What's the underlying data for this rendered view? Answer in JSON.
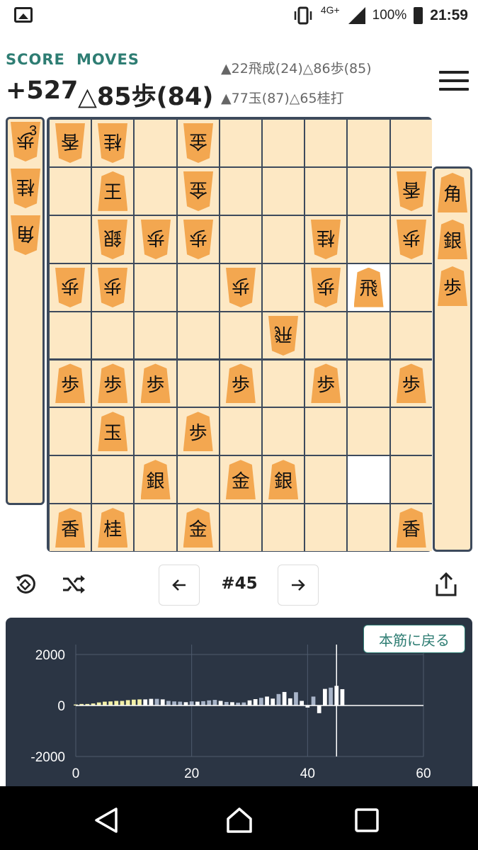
{
  "status_bar": {
    "network": "4G+",
    "battery": "100%",
    "time": "21:59"
  },
  "header": {
    "score_label": "SCORE",
    "moves_label": "MOVES",
    "score": "+527",
    "current_move": "△85歩(84)",
    "history_line1": "▲22飛成(24)△86歩(85)",
    "history_line2": "▲77玉(87)△65桂打"
  },
  "gote_hand": [
    {
      "piece": "歩",
      "count": "3"
    },
    {
      "piece": "桂",
      "count": ""
    },
    {
      "piece": "角",
      "count": ""
    }
  ],
  "sente_hand": [
    {
      "piece": "角"
    },
    {
      "piece": "銀"
    },
    {
      "piece": "歩"
    }
  ],
  "board": {
    "pieces": [
      {
        "row": 1,
        "col": 1,
        "piece": "香",
        "side": "gote"
      },
      {
        "row": 1,
        "col": 2,
        "piece": "桂",
        "side": "gote"
      },
      {
        "row": 1,
        "col": 4,
        "piece": "金",
        "side": "gote"
      },
      {
        "row": 2,
        "col": 2,
        "piece": "王",
        "side": "sente"
      },
      {
        "row": 2,
        "col": 4,
        "piece": "金",
        "side": "gote"
      },
      {
        "row": 2,
        "col": 9,
        "piece": "香",
        "side": "gote"
      },
      {
        "row": 3,
        "col": 2,
        "piece": "銀",
        "side": "gote"
      },
      {
        "row": 3,
        "col": 3,
        "piece": "歩",
        "side": "gote"
      },
      {
        "row": 3,
        "col": 4,
        "piece": "歩",
        "side": "gote"
      },
      {
        "row": 3,
        "col": 7,
        "piece": "桂",
        "side": "gote"
      },
      {
        "row": 3,
        "col": 9,
        "piece": "歩",
        "side": "gote"
      },
      {
        "row": 4,
        "col": 1,
        "piece": "歩",
        "side": "gote"
      },
      {
        "row": 4,
        "col": 2,
        "piece": "歩",
        "side": "gote"
      },
      {
        "row": 4,
        "col": 5,
        "piece": "歩",
        "side": "gote"
      },
      {
        "row": 4,
        "col": 7,
        "piece": "歩",
        "side": "gote"
      },
      {
        "row": 4,
        "col": 8,
        "piece": "飛",
        "side": "sente"
      },
      {
        "row": 5,
        "col": 6,
        "piece": "飛",
        "side": "gote"
      },
      {
        "row": 6,
        "col": 1,
        "piece": "歩",
        "side": "sente"
      },
      {
        "row": 6,
        "col": 2,
        "piece": "歩",
        "side": "sente"
      },
      {
        "row": 6,
        "col": 3,
        "piece": "歩",
        "side": "sente"
      },
      {
        "row": 6,
        "col": 5,
        "piece": "歩",
        "side": "sente"
      },
      {
        "row": 6,
        "col": 7,
        "piece": "歩",
        "side": "sente"
      },
      {
        "row": 6,
        "col": 9,
        "piece": "歩",
        "side": "sente"
      },
      {
        "row": 7,
        "col": 2,
        "piece": "玉",
        "side": "sente"
      },
      {
        "row": 7,
        "col": 4,
        "piece": "歩",
        "side": "sente"
      },
      {
        "row": 8,
        "col": 3,
        "piece": "銀",
        "side": "sente"
      },
      {
        "row": 8,
        "col": 5,
        "piece": "金",
        "side": "sente"
      },
      {
        "row": 8,
        "col": 6,
        "piece": "銀",
        "side": "sente"
      },
      {
        "row": 9,
        "col": 1,
        "piece": "香",
        "side": "sente"
      },
      {
        "row": 9,
        "col": 2,
        "piece": "桂",
        "side": "sente"
      },
      {
        "row": 9,
        "col": 4,
        "piece": "金",
        "side": "sente"
      },
      {
        "row": 9,
        "col": 9,
        "piece": "香",
        "side": "sente"
      }
    ],
    "highlight_white": [
      {
        "row": 4,
        "col": 8
      },
      {
        "row": 8,
        "col": 8
      }
    ]
  },
  "controls": {
    "move_number": "#45",
    "prev_icon": "arrow-left-icon",
    "next_icon": "arrow-right-icon"
  },
  "chart": {
    "back_button": "本筋に戻る"
  },
  "chart_data": {
    "type": "bar",
    "xlim": [
      0,
      60
    ],
    "ylim": [
      -2000,
      2000
    ],
    "x_ticks": [
      "0",
      "20",
      "40",
      "60"
    ],
    "y_ticks": [
      "2000",
      "0",
      "-2000"
    ],
    "current_move": 45,
    "series": [
      {
        "values": [
          40,
          60,
          60,
          80,
          120,
          150,
          160,
          180,
          180,
          210,
          230,
          240,
          240,
          260,
          260,
          240,
          180,
          160,
          150,
          130,
          160,
          150,
          170,
          200,
          220,
          180,
          140,
          130,
          110,
          120,
          200,
          250,
          300,
          350,
          270,
          450,
          530,
          280,
          520,
          180,
          -80,
          350,
          -300,
          650,
          700,
          770,
          640
        ]
      }
    ],
    "colors": {
      "early": "#f3f0a8",
      "mid": "#ffffff",
      "late": "#a8b4c8"
    }
  }
}
